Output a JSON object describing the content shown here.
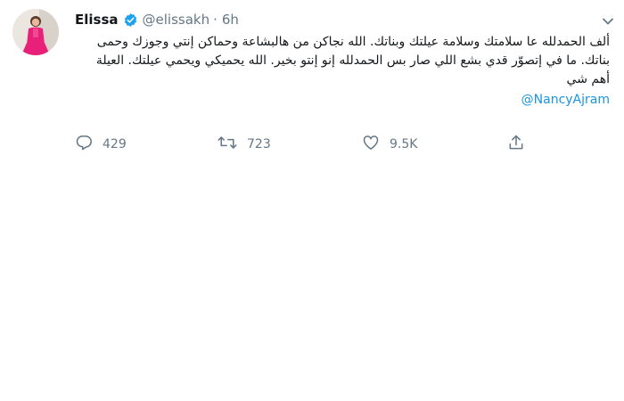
{
  "tweet": {
    "author_name": "Elissa",
    "handle": "@elissakh",
    "separator": "·",
    "time": "6h",
    "text": "ألف الحمدلله عا سلامتك وسلامة عيلتك وبناتك. الله نجاكن من هالبشاعة وحماكن إنتي وجوزك وحمى بناتك. ما في إتصوّر قدي بشع اللي صار بس الحمدلله إنو إنتو بخير. الله يحميكي ويحمي عيلتك. العيلة أهم شي",
    "mention": "@NancyAjram"
  },
  "actions": {
    "reply_count": "429",
    "retweet_count": "723",
    "like_count": "9.5K"
  },
  "icons": {
    "verified": "verified-badge-icon",
    "caret": "chevron-down-icon",
    "reply": "reply-icon",
    "retweet": "retweet-icon",
    "like": "heart-icon",
    "share": "share-icon"
  },
  "colors": {
    "accent": "#1da1f2",
    "link": "#1b95e0",
    "secondary_text": "#657786",
    "avatar_dress": "#e8207a"
  }
}
